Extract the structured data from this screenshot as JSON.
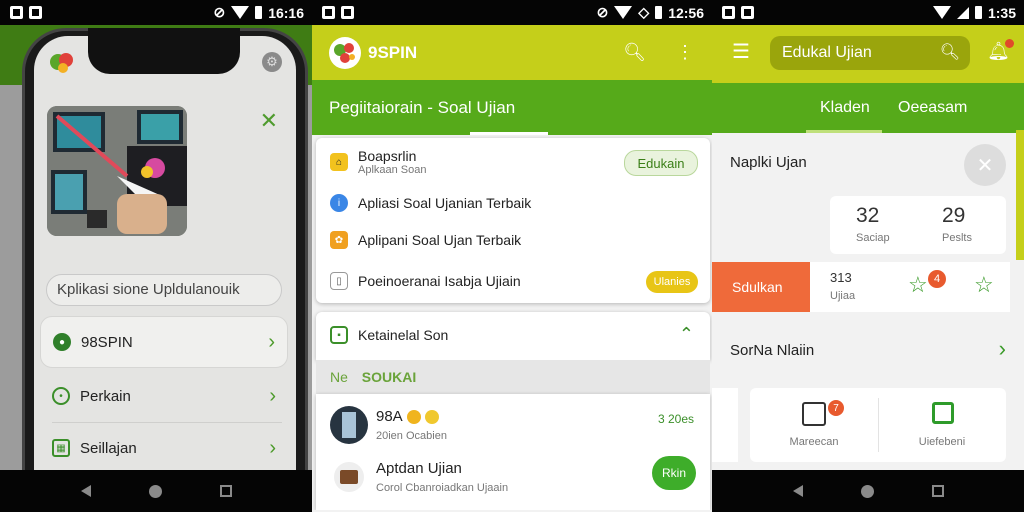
{
  "status_bars": {
    "panel1_time": "16:16",
    "panel2_time": "12:56",
    "panel3_time": "1:35"
  },
  "panel1": {
    "search_placeholder": "Kplikasi sione Upldulanouik",
    "menu": [
      {
        "label": "98SPIN",
        "icon": "spin-icon",
        "selected": true
      },
      {
        "label": "Perkain",
        "icon": "target-icon",
        "selected": false
      },
      {
        "label": "Seillajan",
        "icon": "calendar-icon",
        "selected": false
      }
    ]
  },
  "panel2": {
    "app_title": "9SPIN",
    "subtitle": "Pegiitaiorain - Soal Ujian",
    "dropdown": {
      "header_title": "Boapsrlin",
      "header_sub": "Aplkaan Soan",
      "header_badge": "Edukain",
      "items": [
        {
          "label": "Apliasi Soal Ujanian Terbaik",
          "icon": "info-icon"
        },
        {
          "label": "Aplipani Soal Ujan Terbaik",
          "icon": "app-icon"
        },
        {
          "label": "Poeinoeranai Isabja Ujiain",
          "icon": "doc-icon",
          "badge": "Ulanies"
        }
      ]
    },
    "section_title": "Ketainelal Son",
    "section_sub_label": "Ne",
    "section_sub_value": "SOUKAI",
    "list": [
      {
        "title": "98A",
        "sub": "20ien Ocabien",
        "meta": "3 20es"
      },
      {
        "title": "Aptdan Ujian",
        "sub": "Corol Cbanroiadkan Ujaain",
        "action": "Rkin"
      }
    ]
  },
  "panel3": {
    "search_text": "Edukal Ujian",
    "tabs": [
      "Kladen",
      "Oeeasam"
    ],
    "card_title": "Naplki Ujan",
    "stats": [
      {
        "value": "32",
        "label": "Saciap"
      },
      {
        "value": "29",
        "label": "Peslts"
      }
    ],
    "tile_label": "Sdulkan",
    "tile_value": "313",
    "tile_unit": "Ujiaa",
    "notif_count": "4",
    "row_label": "SorNa Nlaiin",
    "bottom_items": [
      {
        "label": "Mareecan",
        "badge": "7"
      },
      {
        "label": "Uiefebeni"
      }
    ]
  },
  "colors": {
    "lime": "#c5cf1a",
    "green": "#56aa1a",
    "accent_orange": "#ef6a3a"
  }
}
